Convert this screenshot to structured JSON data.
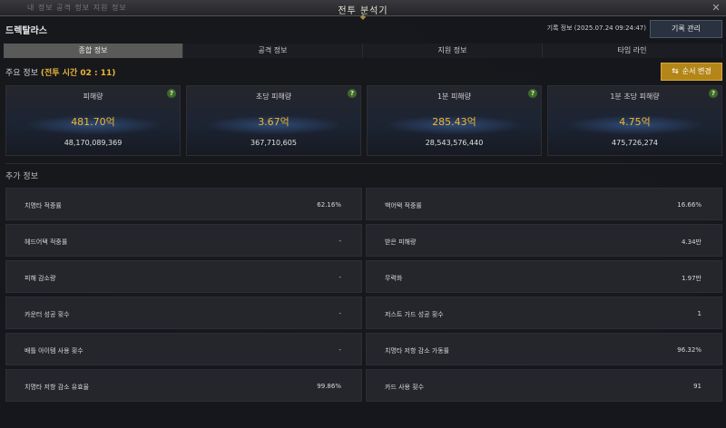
{
  "titlebar": {
    "bg_tabs": "내 정보   공격 정보   지원 정보",
    "title": "전투 분석기",
    "close": "✕"
  },
  "header": {
    "boss_name": "드렉탈라스",
    "record_info": "기록 정보 (2025.07.24 09:24:47)",
    "manage_button": "기록 관리"
  },
  "tabs": [
    {
      "label": "종합 정보",
      "active": true
    },
    {
      "label": "공격 정보",
      "active": false
    },
    {
      "label": "지원 정보",
      "active": false
    },
    {
      "label": "타임 라인",
      "active": false
    }
  ],
  "main": {
    "label": "주요 정보",
    "time": "(전투 시간 02 : 11)",
    "order_button": "순서 변경",
    "order_icon": "swap-icon",
    "help_glyph": "?",
    "cards": [
      {
        "title": "피해량",
        "main": "481.70억",
        "sub": "48,170,089,369"
      },
      {
        "title": "초당 피해량",
        "main": "3.67억",
        "sub": "367,710,605"
      },
      {
        "title": "1분 피해량",
        "main": "285.43억",
        "sub": "28,543,576,440"
      },
      {
        "title": "1분 초당 피해량",
        "main": "4.75억",
        "sub": "475,726,274"
      }
    ]
  },
  "extra": {
    "label": "추가 정보",
    "rows": [
      [
        {
          "k": "치명타 적중률",
          "v": "62.16%"
        },
        {
          "k": "백어택 적중률",
          "v": "16.66%"
        }
      ],
      [
        {
          "k": "헤드어택 적중률",
          "v": "-"
        },
        {
          "k": "받은 피해량",
          "v": "4.34만"
        }
      ],
      [
        {
          "k": "피해 감소량",
          "v": "-"
        },
        {
          "k": "무력화",
          "v": "1.97만"
        }
      ],
      [
        {
          "k": "카운터 성공 횟수",
          "v": "-"
        },
        {
          "k": "저스트 가드 성공 횟수",
          "v": "1"
        }
      ],
      [
        {
          "k": "배틀 아이템 사용 횟수",
          "v": "-"
        },
        {
          "k": "치명타 저항 감소 가동률",
          "v": "96.32%"
        }
      ],
      [
        {
          "k": "치명타 저항 감소 유효율",
          "v": "99.86%"
        },
        {
          "k": "카드 사용 횟수",
          "v": "91"
        }
      ]
    ]
  },
  "colors": {
    "accent_gold": "#f0b92f",
    "button_gold": "#b48618",
    "help_green": "#3d6a2a"
  }
}
